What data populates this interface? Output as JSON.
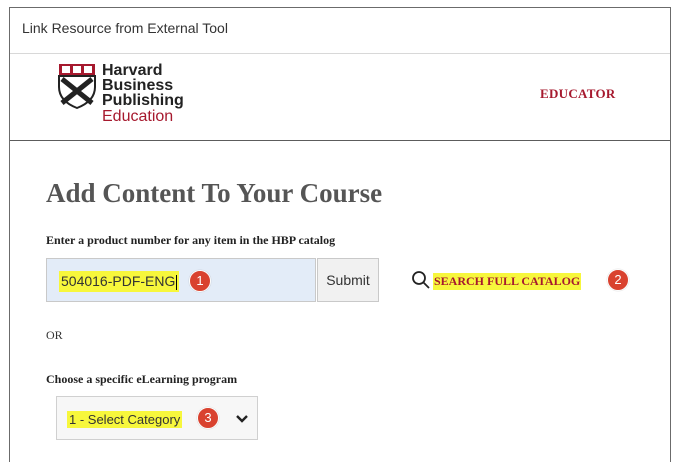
{
  "window": {
    "title": "Link Resource from External Tool"
  },
  "header": {
    "logo_lines": [
      "Harvard",
      "Business",
      "Publishing"
    ],
    "logo_sub": "Education",
    "role": "EDUCATOR"
  },
  "main": {
    "heading": "Add Content To Your Course",
    "product_hint": "Enter a product number for any item in the HBP catalog",
    "product_input": {
      "value": "504016-PDF-ENG",
      "badge": "1"
    },
    "submit_label": "Submit",
    "search_catalog": {
      "label": "SEARCH FULL CATALOG",
      "icon": "search-icon",
      "badge": "2"
    },
    "or_text": "OR",
    "program_label": "Choose a specific eLearning program",
    "category_select": {
      "selected": "1 - Select Category",
      "badge": "3",
      "icon": "chevron-down-icon"
    }
  },
  "colors": {
    "brand": "#a6192e",
    "highlight": "#f7f73c",
    "badge": "#d9422f",
    "input_bg": "#e3ecf8"
  }
}
